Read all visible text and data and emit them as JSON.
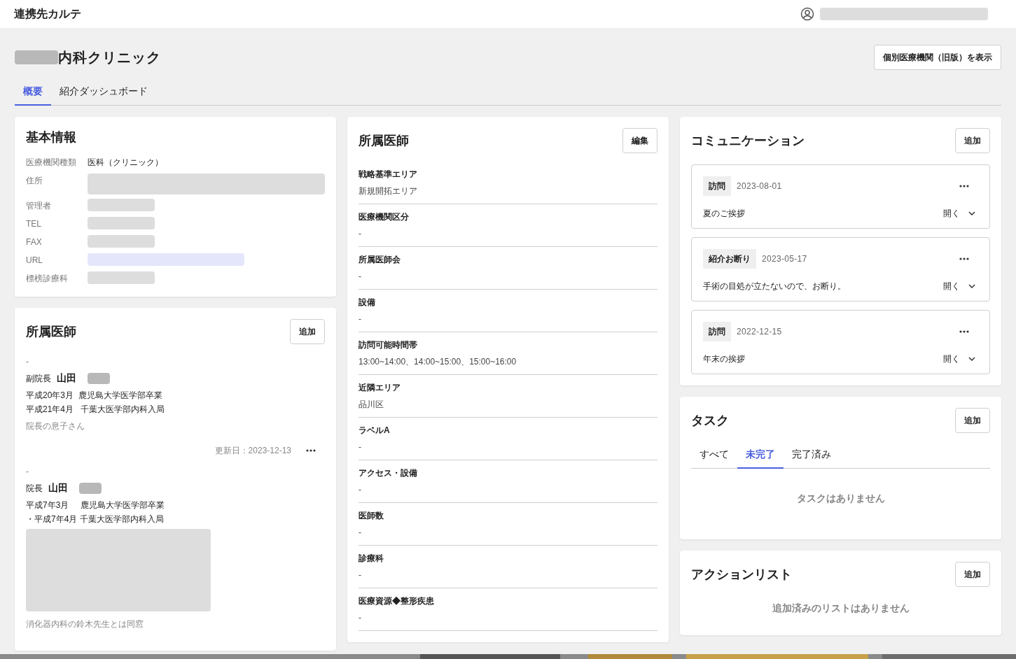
{
  "app": {
    "title": "連携先カルテ"
  },
  "page": {
    "title": "内科クリニック",
    "legacy_button": "個別医療機関（旧版）を表示"
  },
  "tabs": [
    {
      "label": "概要",
      "selected": true
    },
    {
      "label": "紹介ダッシュボード",
      "selected": false
    }
  ],
  "basic_info": {
    "title": "基本情報",
    "rows": [
      {
        "label": "医療機関種類",
        "value": "医科（クリニック）"
      },
      {
        "label": "住所"
      },
      {
        "label": "管理者"
      },
      {
        "label": "TEL"
      },
      {
        "label": "FAX"
      },
      {
        "label": "URL",
        "kind": "link"
      },
      {
        "label": "標榜診療科"
      }
    ]
  },
  "doctors": {
    "title": "所属医師",
    "add_button": "追加",
    "items": [
      {
        "dash": "-",
        "role": "副院長",
        "name": "山田",
        "career": [
          "平成20年3月  鹿児島大学医学部卒業",
          "平成21年4月   千葉大医学部内科入局"
        ],
        "redacted_block": false,
        "remark": "院長の息子さん",
        "updated": "更新日：2023-12-13"
      },
      {
        "dash": "-",
        "role": "院長",
        "name": "山田",
        "career": [
          "平成7年3月     鹿児島大学医学部卒業",
          "・平成7年4月 千葉大医学部内科入局"
        ],
        "redacted_block": true,
        "remark": "消化器内科の鈴木先生とは同窓"
      }
    ]
  },
  "details": {
    "title": "所属医師",
    "edit_button": "編集",
    "fields": [
      {
        "label": "戦略基準エリア",
        "value": "新規開拓エリア"
      },
      {
        "label": "医療機関区分",
        "value": "-"
      },
      {
        "label": "所属医師会",
        "value": "-"
      },
      {
        "label": "設備",
        "value": "-"
      },
      {
        "label": "訪問可能時間帯",
        "value": "13:00~14:00、14:00~15:00、15:00~16:00"
      },
      {
        "label": "近隣エリア",
        "value": "品川区"
      },
      {
        "label": "ラベルA",
        "value": "-"
      },
      {
        "label": "アクセス・設備",
        "value": "-"
      },
      {
        "label": "医師数",
        "value": "-"
      },
      {
        "label": "診療科",
        "value": "-"
      },
      {
        "label": "医療資源◆整形疾患",
        "value": "-"
      }
    ]
  },
  "communication": {
    "title": "コミュニケーション",
    "add_button": "追加",
    "items": [
      {
        "type": "訪問",
        "date": "2023-08-01",
        "text": "夏のご挨拶",
        "open": "開く"
      },
      {
        "type": "紹介お断り",
        "date": "2023-05-17",
        "text": "手術の目処が立たないので、お断り。",
        "open": "開く"
      },
      {
        "type": "訪問",
        "date": "2022-12-15",
        "text": "年末の挨拶",
        "open": "開く"
      }
    ]
  },
  "tasks": {
    "title": "タスク",
    "add_button": "追加",
    "tabs": [
      {
        "label": "すべて",
        "selected": false
      },
      {
        "label": "未完了",
        "selected": true
      },
      {
        "label": "完了済み",
        "selected": false
      }
    ],
    "empty": "タスクはありません"
  },
  "action_list": {
    "title": "アクションリスト",
    "add_button": "追加",
    "empty": "追加済みのリストはありません"
  }
}
